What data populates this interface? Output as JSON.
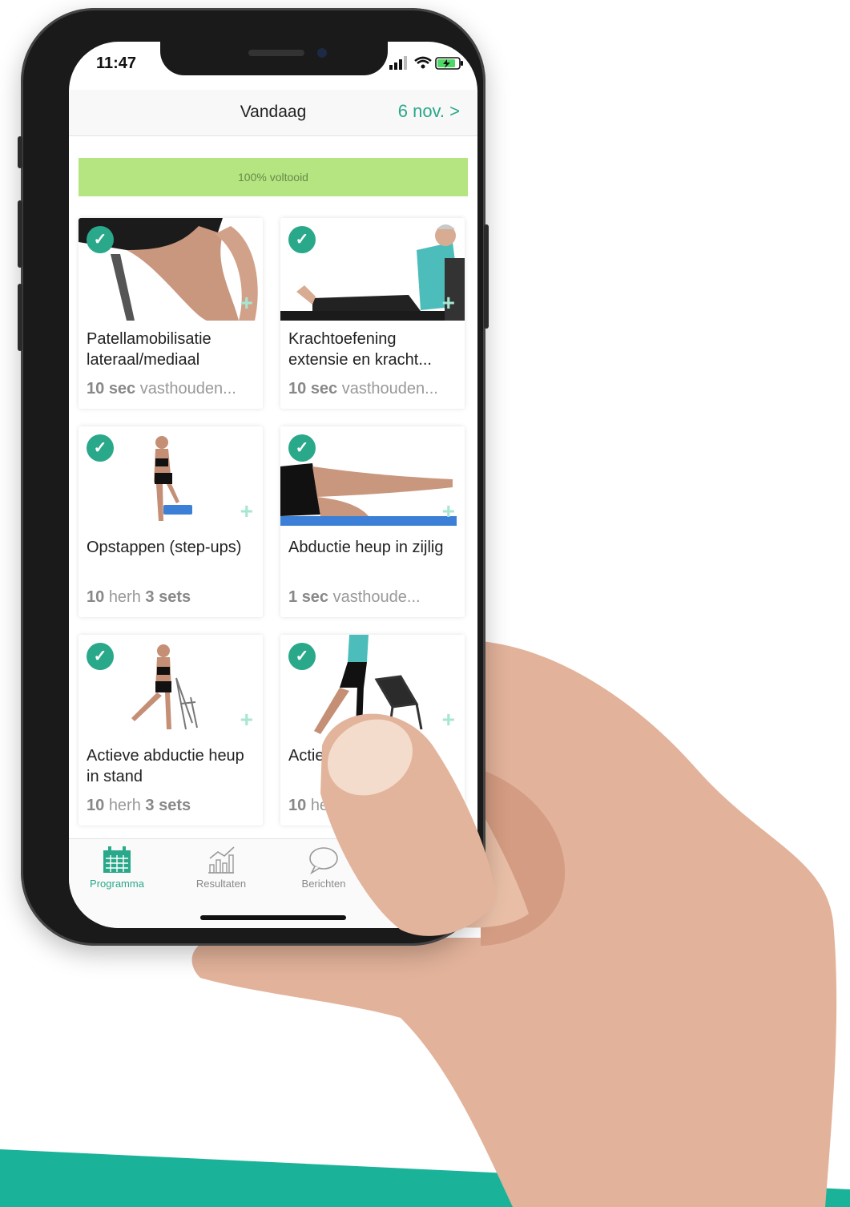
{
  "colors": {
    "accent": "#2aa88a",
    "progress": "#b4e581",
    "band": "#1ab39a",
    "skin": "#e2b29a"
  },
  "status": {
    "time": "11:47"
  },
  "header": {
    "title": "Vandaag",
    "date_nav": "6 nov. >"
  },
  "progress": {
    "label": "100% voltooid",
    "value": 1.0
  },
  "exercises": [
    {
      "title": "Patellamobilisatie lateraal/mediaal",
      "sub_num": "10",
      "sub_unit": "sec",
      "sub_rest": "vasthouden...",
      "done": true
    },
    {
      "title": "Krachtoefening extensie en kracht...",
      "sub_num": "10",
      "sub_unit": "sec",
      "sub_rest": "vasthouden...",
      "done": true
    },
    {
      "title": "Opstappen (step-ups)",
      "sub_num": "10",
      "sub_unit": "herh",
      "sub_rest": "3 sets",
      "done": true
    },
    {
      "title": "Abductie heup in zijlig",
      "sub_num": "1",
      "sub_unit": "sec",
      "sub_rest": "vasthoude...",
      "done": true
    },
    {
      "title": "Actieve abductie heup in stand",
      "sub_num": "10",
      "sub_unit": "herh",
      "sub_rest": "3 sets",
      "done": true
    },
    {
      "title": "Actiev heup",
      "sub_num": "10",
      "sub_unit": "herl",
      "sub_rest": "",
      "done": true
    }
  ],
  "tabs": [
    {
      "label": "Programma",
      "icon": "calendar-icon",
      "active": true
    },
    {
      "label": "Resultaten",
      "icon": "chart-icon",
      "active": false
    },
    {
      "label": "Berichten",
      "icon": "chat-icon",
      "active": false
    }
  ]
}
